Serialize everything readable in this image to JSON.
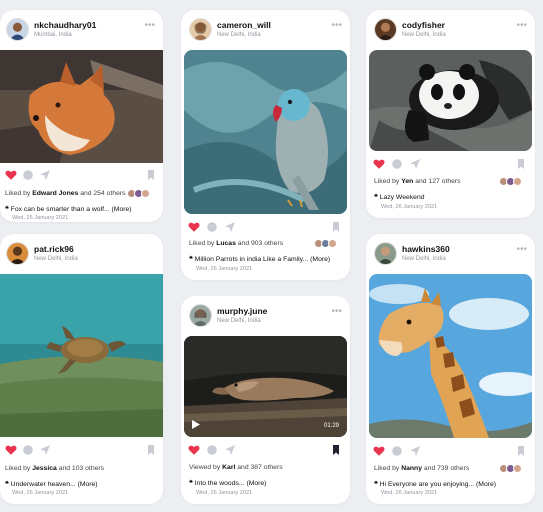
{
  "posts": [
    {
      "username": "nkchaudhary01",
      "location": "Mumbai, India",
      "likes_prefix": "Liked by",
      "likes_name": "Edward Jones",
      "likes_suffix": "and 254 others",
      "caption": "Fox can be smarter than a wolf...",
      "more": "(More)",
      "date": "Wed, 26 January 2021",
      "liked": true,
      "saved": false,
      "image": "fox-photo"
    },
    {
      "username": "cameron_will",
      "location": "New Delhi, India",
      "likes_prefix": "Liked by",
      "likes_name": "Lucas",
      "likes_suffix": "and 903 others",
      "caption": "Million Parrots in india Like a Family...",
      "more": "(More)",
      "date": "Wed, 26 January 2021",
      "liked": true,
      "saved": false,
      "image": "parrot-photo"
    },
    {
      "username": "codyfisher",
      "location": "New Delhi, India",
      "likes_prefix": "Liked by",
      "likes_name": "Yen",
      "likes_suffix": "and 127 others",
      "caption": "Lazy Weekend",
      "more": "",
      "date": "Wed, 26 January 2021",
      "liked": true,
      "saved": false,
      "image": "panda-photo"
    },
    {
      "username": "pat.rick96",
      "location": "New Delhi, India",
      "likes_prefix": "Liked by",
      "likes_name": "Jessica",
      "likes_suffix": "and 103 others",
      "caption": "Underwater heaven...",
      "more": "(More)",
      "date": "Wed, 26 January 2021",
      "liked": true,
      "saved": false,
      "image": "turtle-photo"
    },
    {
      "username": "murphy.june",
      "location": "New Delhi, India",
      "likes_prefix": "Viewed by",
      "likes_name": "Karl",
      "likes_suffix": "and 387 others",
      "caption": "Into the woods...",
      "more": "(More)",
      "date": "Wed, 26 January 2021",
      "liked": true,
      "saved": true,
      "image": "lizard-video",
      "duration": "01:29"
    },
    {
      "username": "hawkins360",
      "location": "New Delhi, India",
      "likes_prefix": "Liked by",
      "likes_name": "Nanny",
      "likes_suffix": "and 739 others",
      "caption": "Hi Everyone are you enjoying...",
      "more": "(More)",
      "date": "Wed, 26 January 2021",
      "liked": true,
      "saved": false,
      "image": "giraffe-photo"
    }
  ],
  "icons": {
    "more": "more-dots-icon",
    "like": "heart-icon",
    "comment": "comment-icon",
    "share": "send-icon",
    "save": "bookmark-icon",
    "quote": "quote-icon",
    "play": "play-icon"
  },
  "colors": {
    "heart": "#e8344e",
    "muted_icon": "#c9cdd3",
    "saved_bookmark": "#1f2430",
    "page_background": "#eceef1"
  }
}
